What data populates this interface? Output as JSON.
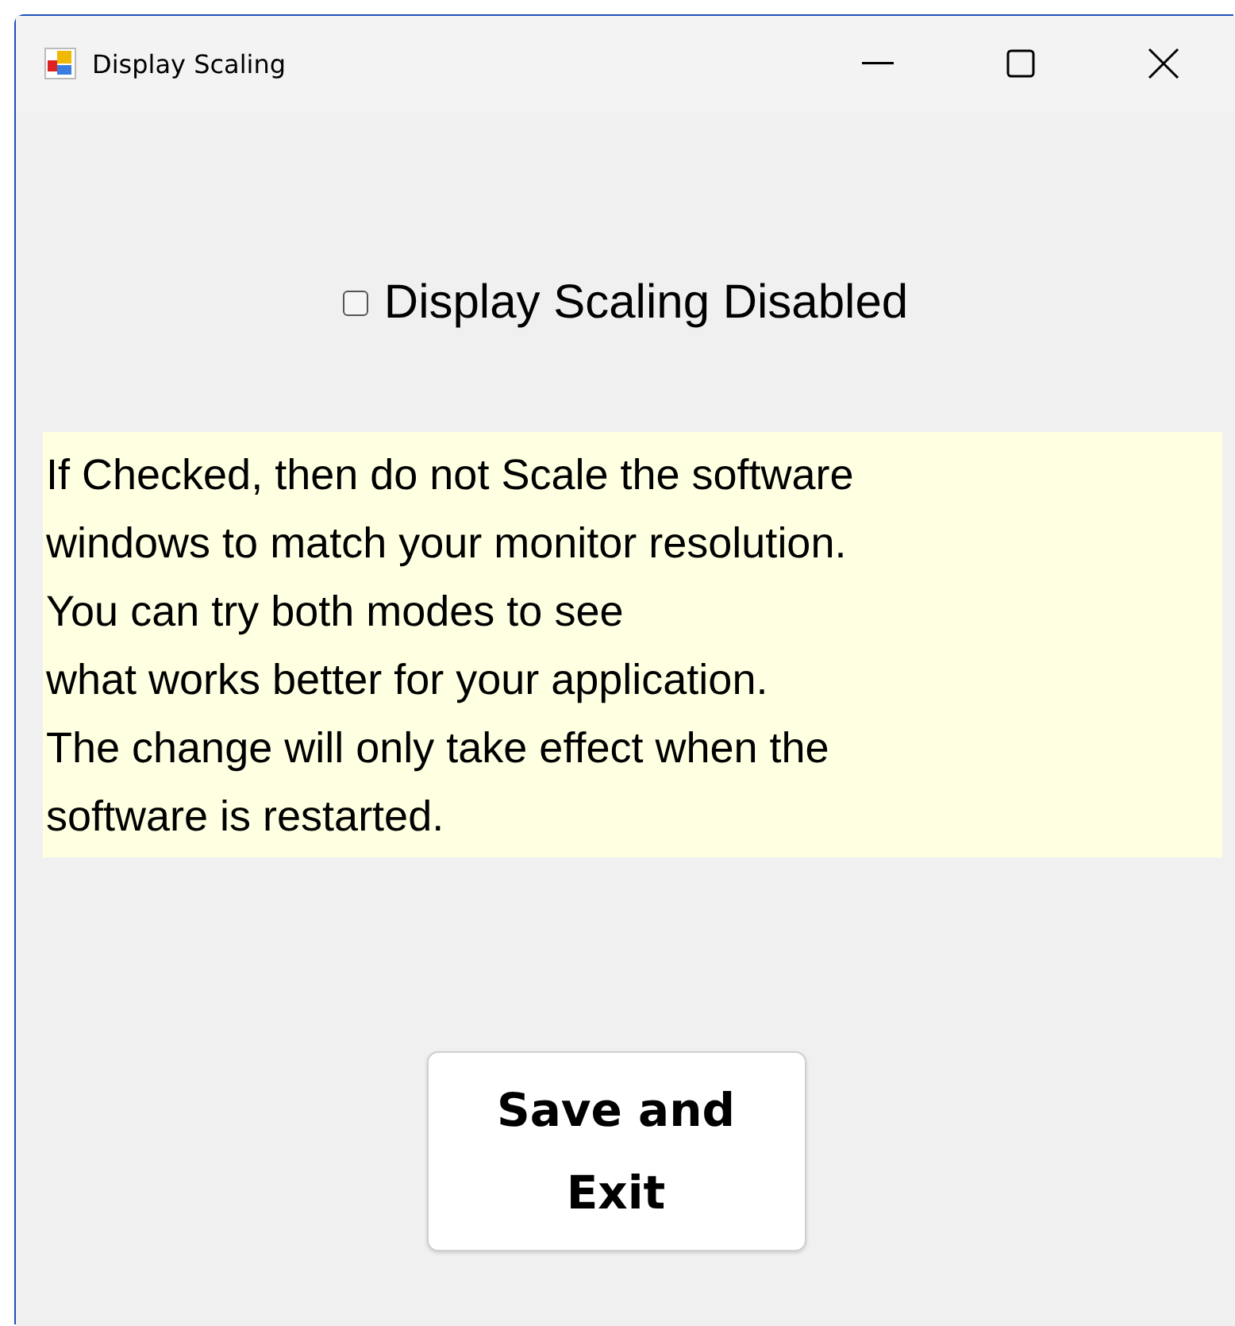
{
  "window": {
    "title": "Display Scaling"
  },
  "checkbox": {
    "label": "Display Scaling Disabled",
    "checked": false
  },
  "description": "If Checked, then do not Scale the software\nwindows to match your monitor resolution.\nYou can try both modes to see\nwhat works better for your application.\nThe change will only take effect when the\nsoftware is restarted.",
  "button": {
    "label": "Save and\nExit"
  }
}
